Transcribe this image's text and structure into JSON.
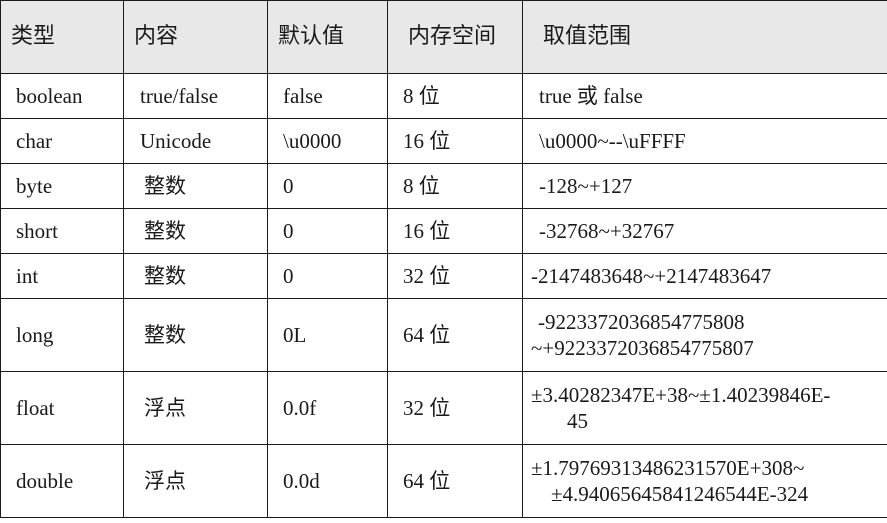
{
  "headers": [
    "类型",
    "内容",
    "默认值",
    "内存空间",
    "取值范围"
  ],
  "rows": [
    {
      "type": "boolean",
      "content": "true/false",
      "default": "false",
      "memory_num": "8",
      "memory_unit": "位",
      "range_lines": [
        "true 或 false"
      ]
    },
    {
      "type": "char",
      "content": "Unicode",
      "default": "\\u0000",
      "memory_num": "16",
      "memory_unit": "位",
      "range_lines": [
        "\\u0000~--\\uFFFF"
      ]
    },
    {
      "type": "byte",
      "content": "整数",
      "default": "0",
      "memory_num": "8",
      "memory_unit": "位",
      "range_lines": [
        "-128~+127"
      ]
    },
    {
      "type": "short",
      "content": "整数",
      "default": "0",
      "memory_num": "16",
      "memory_unit": "位",
      "range_lines": [
        "-32768~+32767"
      ]
    },
    {
      "type": "int",
      "content": "整数",
      "default": "0",
      "memory_num": "32",
      "memory_unit": "位",
      "range_lines": [
        "-2147483648~+2147483647"
      ]
    },
    {
      "type": "long",
      "content": "整数",
      "default": "0L",
      "memory_num": "64",
      "memory_unit": "位",
      "range_lines": [
        "-9223372036854775808",
        "~+9223372036854775807"
      ]
    },
    {
      "type": "float",
      "content": "浮点",
      "default": "0.0f",
      "memory_num": "32",
      "memory_unit": "位",
      "range_lines": [
        "±3.40282347E+38~±1.40239846E-",
        "45"
      ]
    },
    {
      "type": "double",
      "content": "浮点",
      "default": "0.0d",
      "memory_num": "64",
      "memory_unit": "位",
      "range_lines": [
        "±1.79769313486231570E+308~",
        "±4.94065645841246544E-324"
      ]
    }
  ]
}
